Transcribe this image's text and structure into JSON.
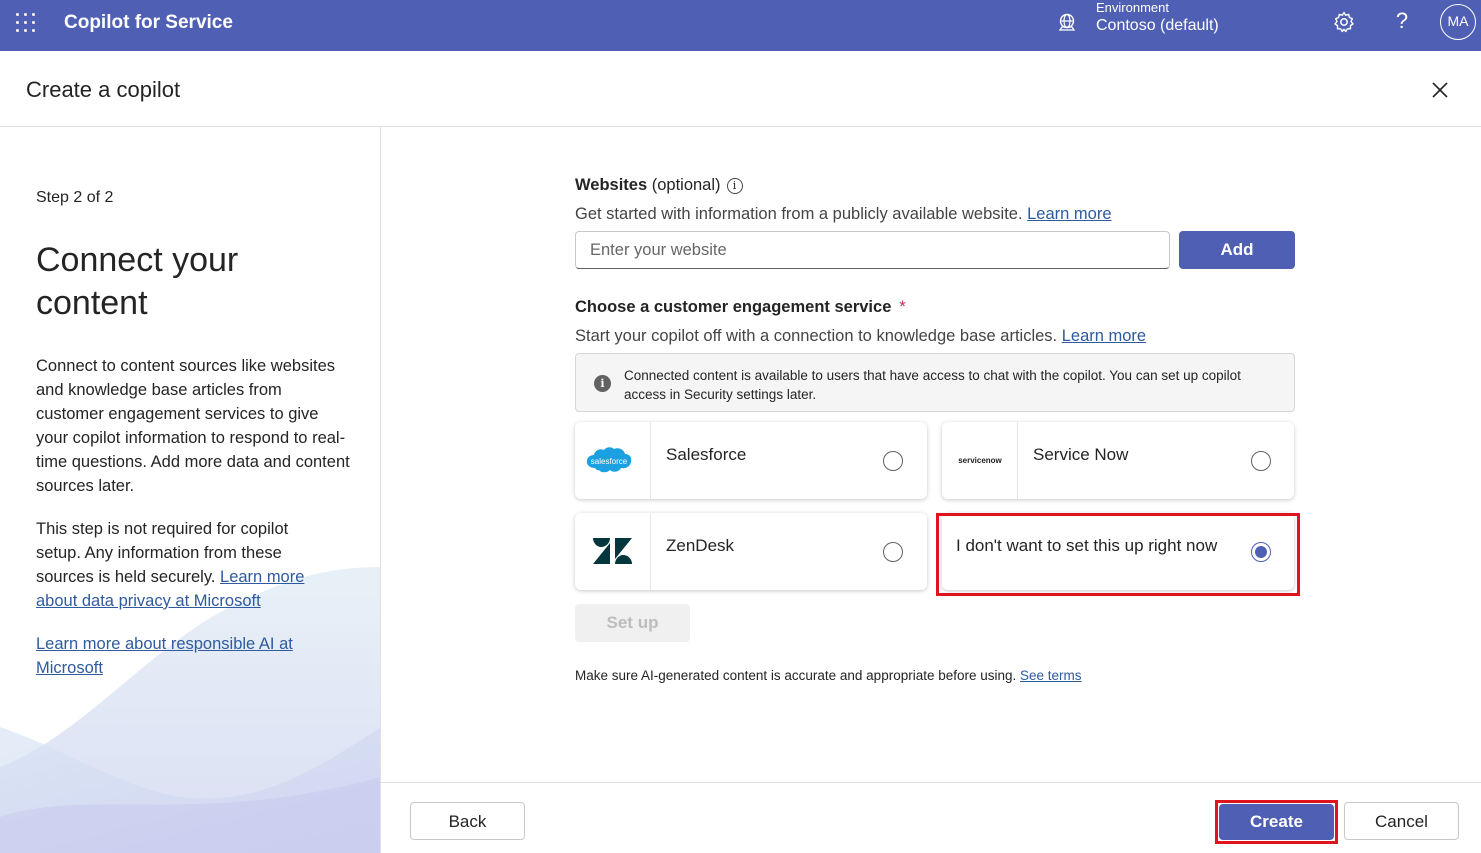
{
  "topbar": {
    "app_title": "Copilot for Service",
    "environment_label": "Environment",
    "environment_value": "Contoso (default)",
    "avatar_initials": "MA",
    "help_glyph": "?",
    "bar_color": "#4f5fb3"
  },
  "dialog": {
    "title": "Create a copilot"
  },
  "left": {
    "step": "Step 2 of 2",
    "heading": "Connect your content",
    "description": "Connect to content sources like websites and knowledge base articles from customer engagement services to give your copilot information to respond to real-time questions. Add more data and content sources later.",
    "not_required_text": "This step is not required for copilot setup. Any information from these sources is held securely. ",
    "privacy_link": "Learn more about data privacy at Microsoft",
    "responsible_ai_link": "Learn more about responsible AI at Microsoft"
  },
  "websites": {
    "label": "Websites",
    "optional": "(optional)",
    "info_glyph": "i",
    "description": "Get started with information from a publicly available website. ",
    "learn_more": "Learn more",
    "input_placeholder": "Enter your website",
    "input_value": "",
    "add_label": "Add"
  },
  "engagement": {
    "label": "Choose a customer engagement service",
    "required_mark": "*",
    "description": "Start your copilot off with a connection to knowledge base articles. ",
    "learn_more": "Learn more",
    "notice_icon_glyph": "i",
    "notice": "Connected content is available to users that have access to chat with the copilot. You can set up copilot access in Security settings later.",
    "options": [
      {
        "label": "Salesforce",
        "logo": "salesforce-logo",
        "logo_text": "salesforce",
        "selected": false
      },
      {
        "label": "Service Now",
        "logo": "servicenow-logo",
        "logo_text": "servicenow",
        "selected": false
      },
      {
        "label": "ZenDesk",
        "logo": "zendesk-logo",
        "selected": false
      },
      {
        "label": "I don't want to set this up right now",
        "selected": true
      }
    ],
    "setup_label": "Set up"
  },
  "disclaimer": {
    "text": "Make sure AI-generated content is accurate and appropriate before using. ",
    "link": "See terms"
  },
  "footer": {
    "back_label": "Back",
    "create_label": "Create",
    "cancel_label": "Cancel"
  },
  "colors": {
    "primary": "#4f5fb3",
    "highlight": "#e0141e",
    "link": "#2f5a9e"
  }
}
